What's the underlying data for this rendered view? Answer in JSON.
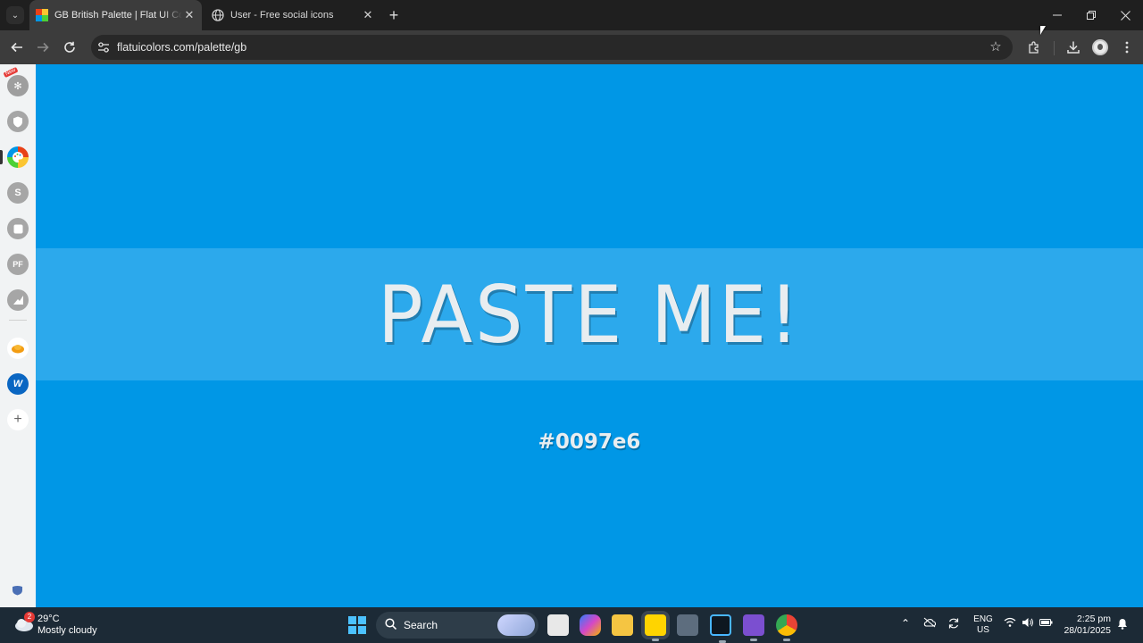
{
  "browser": {
    "tabs": [
      {
        "title": "GB British Palette | Flat UI Colors",
        "active": true
      },
      {
        "title": "User - Free social icons",
        "active": false
      }
    ],
    "url": "flatuicolors.com/palette/gb"
  },
  "page": {
    "background_color": "#0097e6",
    "band_color": "#2ca9ec",
    "headline": "PASTE ME!",
    "color_hex": "#0097e6"
  },
  "sidebar": {
    "new_badge": "New",
    "items": [
      "icon-1",
      "icon-2",
      "palette-icon",
      "s-icon",
      "icon-5",
      "pf-icon",
      "chart-icon",
      "orange-icon",
      "w-icon",
      "add-icon"
    ]
  },
  "taskbar": {
    "weather_badge": "2",
    "weather_temp": "29°C",
    "weather_desc": "Mostly cloudy",
    "search_label": "Search",
    "lang_line1": "ENG",
    "lang_line2": "US",
    "time": "2:25 pm",
    "date": "28/01/2025"
  }
}
